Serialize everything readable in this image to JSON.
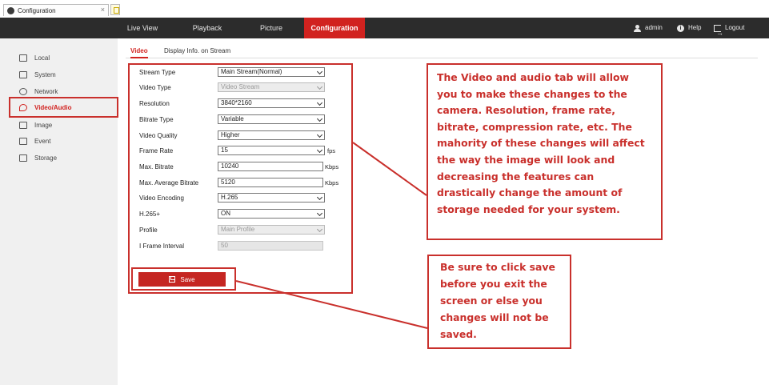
{
  "browser": {
    "tab_title": "Configuration",
    "close_glyph": "×"
  },
  "nav": {
    "live_view": "Live View",
    "playback": "Playback",
    "picture": "Picture",
    "configuration": "Configuration",
    "admin": "admin",
    "help": "Help",
    "logout": "Logout"
  },
  "sidebar": {
    "items": [
      {
        "label": "Local",
        "icon": "monitor-icon"
      },
      {
        "label": "System",
        "icon": "system-icon"
      },
      {
        "label": "Network",
        "icon": "globe-icon"
      },
      {
        "label": "Video/Audio",
        "icon": "video-audio-icon",
        "active": true
      },
      {
        "label": "Image",
        "icon": "image-icon"
      },
      {
        "label": "Event",
        "icon": "calendar-icon"
      },
      {
        "label": "Storage",
        "icon": "storage-icon"
      }
    ]
  },
  "subtabs": {
    "video": "Video",
    "display_info": "Display Info. on Stream"
  },
  "form": {
    "stream_type": {
      "label": "Stream Type",
      "value": "Main Stream(Normal)"
    },
    "video_type": {
      "label": "Video Type",
      "value": "Video Stream"
    },
    "resolution": {
      "label": "Resolution",
      "value": "3840*2160"
    },
    "bitrate_type": {
      "label": "Bitrate Type",
      "value": "Variable"
    },
    "video_quality": {
      "label": "Video Quality",
      "value": "Higher"
    },
    "frame_rate": {
      "label": "Frame Rate",
      "value": "15",
      "unit": "fps"
    },
    "max_bitrate": {
      "label": "Max. Bitrate",
      "value": "10240",
      "unit": "Kbps"
    },
    "max_avg_bitrate": {
      "label": "Max. Average Bitrate",
      "value": "5120",
      "unit": "Kbps"
    },
    "video_encoding": {
      "label": "Video Encoding",
      "value": "H.265"
    },
    "h265plus": {
      "label": "H.265+",
      "value": "ON"
    },
    "profile": {
      "label": "Profile",
      "value": "Main Profile"
    },
    "i_frame_interval": {
      "label": "I Frame Interval",
      "value": "50"
    },
    "save_label": "Save"
  },
  "annotations": {
    "callout_video_lines": [
      "The Video and audio tab will allow",
      "you to make these changes to the",
      "camera. Resolution, frame rate,",
      "bitrate, compression rate, etc. The",
      "mahority of these changes will affect",
      "the way the image will look and",
      "decreasing the features can",
      "drastically change the amount of",
      "storage needed for your system."
    ],
    "callout_save_lines": [
      "Be sure to click save",
      "before you exit the",
      "screen or else you",
      "changes will not be",
      "saved."
    ],
    "highlight_color": "#c9302c"
  },
  "colors": {
    "accent": "#d1221f",
    "nav_bg": "#2c2c2c",
    "sidebar_bg": "#f0f0f0"
  }
}
